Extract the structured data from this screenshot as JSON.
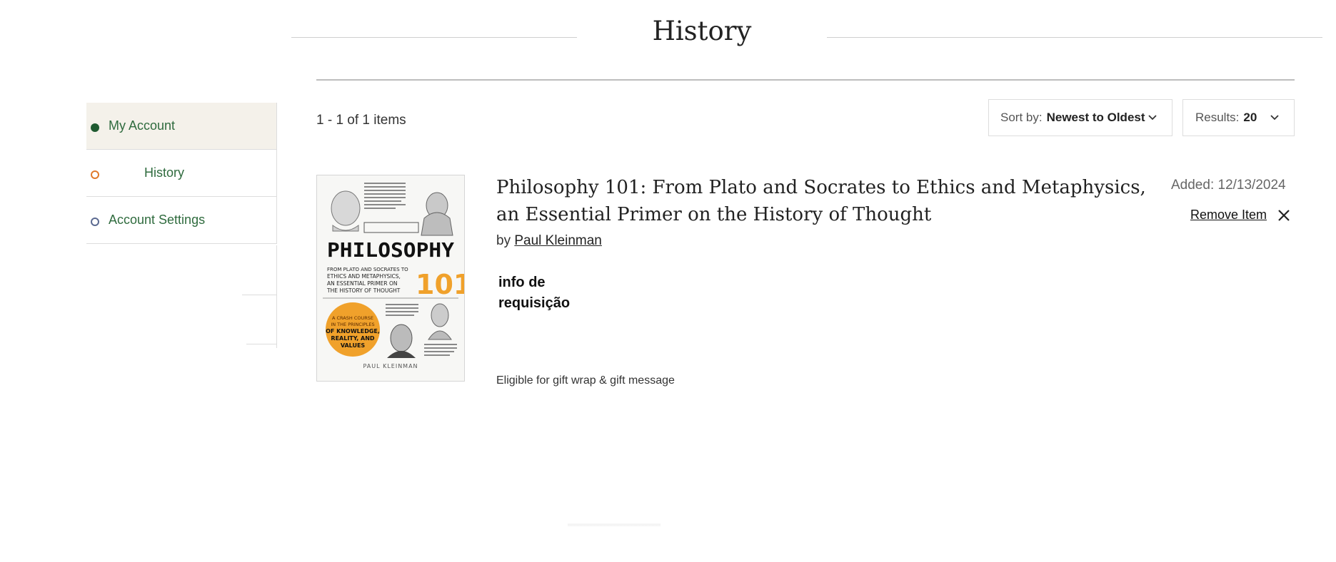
{
  "page": {
    "title": "History"
  },
  "sidebar": {
    "items": [
      {
        "label": "My Account",
        "state": "active",
        "bullet_color": "#1f5a30"
      },
      {
        "label": "History",
        "state": "current",
        "bullet_color": "#e07a2b"
      },
      {
        "label": "Account Settings",
        "state": "default",
        "bullet_color": "#5b6a91"
      }
    ]
  },
  "results": {
    "count_label": "1 - 1 of 1 items",
    "sort": {
      "label": "Sort by:",
      "value": "Newest to Oldest"
    },
    "per_page": {
      "label": "Results:",
      "value": "20"
    }
  },
  "item": {
    "title": "Philosophy 101: From Plato and Socrates to Ethics and Metaphysics, an Essential Primer on the History of Thought",
    "by_label": "by",
    "author": "Paul Kleinman",
    "request_info": "info de requisição",
    "gift_message": "Eligible for gift wrap & gift message",
    "added": "Added: 12/13/2024",
    "remove_label": "Remove Item",
    "cover": {
      "title_word": "PHILOSOPHY",
      "number": "101",
      "subtitle_1": "FROM PLATO AND SOCRATES TO",
      "subtitle_2": "ETHICS AND METAPHYSICS,",
      "subtitle_3": "AN ESSENTIAL PRIMER ON",
      "subtitle_4": "THE HISTORY OF THOUGHT",
      "badge_1": "A CRASH COURSE",
      "badge_2": "IN THE PRINCIPLES",
      "badge_3": "OF KNOWLEDGE,",
      "badge_4": "REALITY, AND",
      "badge_5": "VALUES",
      "author": "PAUL KLEINMAN"
    }
  },
  "colors": {
    "accent_green": "#2f6b3e",
    "active_bg": "#f4f1ea",
    "cover_orange": "#f0a12b"
  }
}
